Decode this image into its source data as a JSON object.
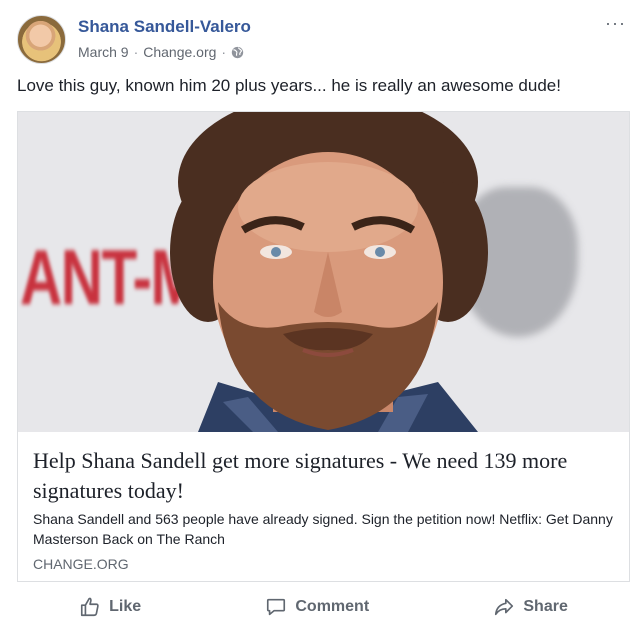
{
  "post": {
    "author": "Shana Sandell-Valero",
    "date": "March 9",
    "source": "Change.org",
    "separator": "·",
    "privacy_icon": "globe-icon",
    "more_label": "···",
    "text": "Love this guy, known him 20 plus years... he is really an awesome dude!"
  },
  "card": {
    "image_text": "ANT-MA",
    "title": "Help Shana Sandell get more signatures - We need 139 more signatures today!",
    "description": "Shana Sandell and 563 people have already signed. Sign the petition now! Netflix: Get Danny Masterson Back on The Ranch",
    "domain": "CHANGE.ORG"
  },
  "actions": {
    "like": "Like",
    "comment": "Comment",
    "share": "Share"
  },
  "colors": {
    "link": "#365899",
    "meta": "#616770",
    "action": "#606770"
  }
}
